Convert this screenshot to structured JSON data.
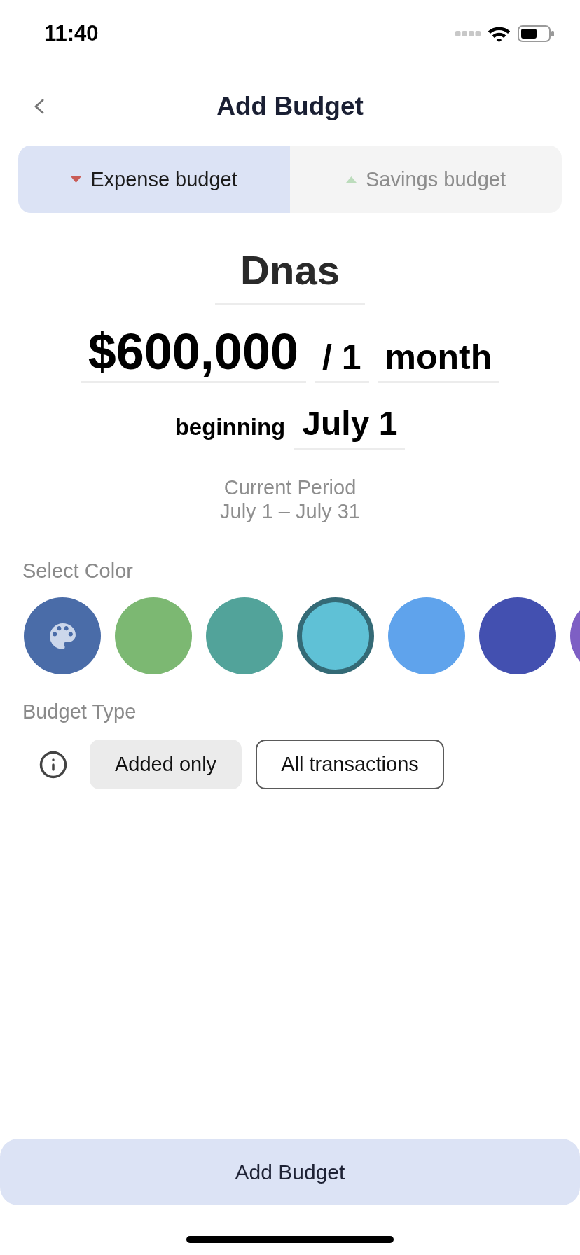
{
  "status_bar": {
    "time": "11:40"
  },
  "header": {
    "title": "Add Budget"
  },
  "tabs": [
    {
      "kind": "expense",
      "label": "Expense budget",
      "selected": true
    },
    {
      "kind": "savings",
      "label": "Savings budget",
      "selected": false
    }
  ],
  "budget": {
    "name": "Dnas",
    "amount": "$600,000",
    "period_count": "/ 1",
    "period_unit": "month",
    "beginning_label": "beginning",
    "start_date": "July 1"
  },
  "current_period": {
    "title": "Current Period",
    "range": "July 1 – July 31"
  },
  "color_picker": {
    "label": "Select Color",
    "swatches": [
      {
        "kind": "custom",
        "color": "#4a6ca8",
        "selected": false
      },
      {
        "kind": "preset",
        "color": "#7cb872",
        "selected": false
      },
      {
        "kind": "preset",
        "color": "#52a39a",
        "selected": false
      },
      {
        "kind": "preset",
        "color": "#5fc1d6",
        "selected": true
      },
      {
        "kind": "preset",
        "color": "#5fa3ec",
        "selected": false
      },
      {
        "kind": "preset",
        "color": "#4350b0",
        "selected": false
      },
      {
        "kind": "preset",
        "color": "#7e5fc4",
        "selected": false
      }
    ]
  },
  "budget_type": {
    "label": "Budget Type",
    "options": [
      {
        "label": "Added only",
        "selected": true
      },
      {
        "label": "All transactions",
        "selected": false
      }
    ]
  },
  "submit_button": {
    "label": "Add Budget"
  }
}
